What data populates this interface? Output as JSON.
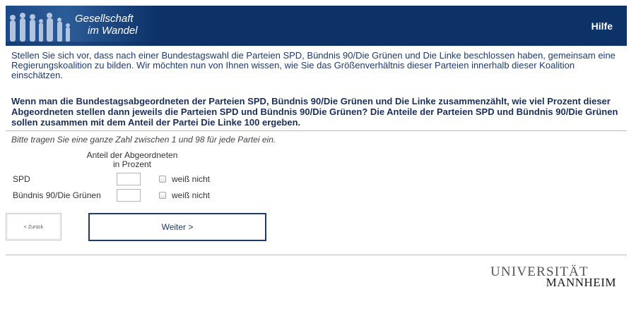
{
  "header": {
    "logo_line1": "Gesellschaft",
    "logo_line2": "im Wandel",
    "help_label": "Hilfe",
    "color": "#0d3268"
  },
  "intro": "Stellen Sie sich vor, dass nach einer Bundestagswahl die Parteien SPD, Bündnis 90/Die Grünen und Die Linke beschlossen haben, gemeinsam eine Regierungskoalition zu bilden. Wir möchten nun von Ihnen wissen, wie Sie das Größenverhältnis dieser Parteien innerhalb dieser Koalition einschätzen.",
  "question": "Wenn man die Bundestagsabgeordneten der Parteien SPD, Bündnis 90/Die Grünen und Die Linke zusammenzählt, wie viel Prozent dieser Abgeordneten stellen dann jeweils die Parteien SPD und Bündnis 90/Die Grünen? Die Anteile der Parteien SPD und Bündnis 90/Die Grünen sollen zusammen mit dem Anteil der Partei Die Linke 100 ergeben.",
  "hint": "Bitte tragen Sie eine ganze Zahl zwischen 1 und 98 für jede Partei ein.",
  "table": {
    "column_header_line1": "Anteil der Abgeordneten",
    "column_header_line2": "in Prozent",
    "rows": [
      {
        "label": "SPD",
        "value": "",
        "dont_know_label": "weiß nicht",
        "dont_know_checked": false
      },
      {
        "label": "Bündnis 90/Die Grünen",
        "value": "",
        "dont_know_label": "weiß nicht",
        "dont_know_checked": false
      }
    ]
  },
  "nav": {
    "back_label": "< Zurück",
    "next_label": "Weiter >"
  },
  "footer": {
    "logo_line1": "UNIVERSITÄT",
    "logo_line2": "MANNHEIM"
  }
}
